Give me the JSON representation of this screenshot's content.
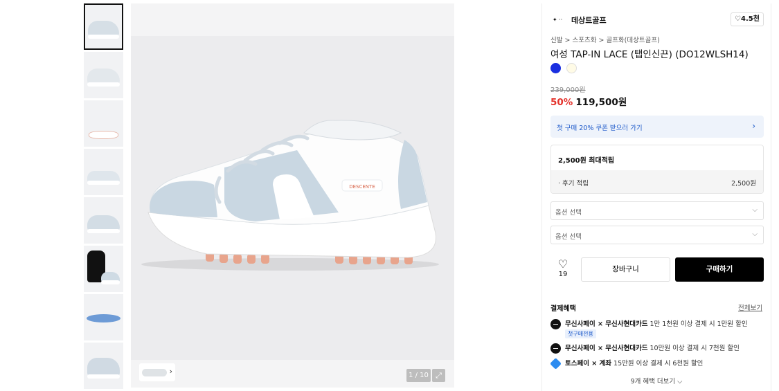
{
  "gallery": {
    "thumbnail_count": 8,
    "counter": "1 / 10",
    "strip_arrow": "›",
    "expand_icon": "⤢"
  },
  "brand": {
    "logo_text": "✦ ··",
    "name": "데상트골프",
    "likes": "♡4.5천"
  },
  "breadcrumb": "신발 > 스포츠화 > 골프화(데상트골프)",
  "product": {
    "title": "여성 TAP-IN LACE (탭인신끈) (DO12WLSH14)",
    "colors": [
      "#1a2fe0",
      "#fffbe6"
    ],
    "original_price": "239,000원",
    "discount": "50%",
    "price": "119,500원"
  },
  "coupon": {
    "text": "첫 구매 20% 쿠폰 받으러 가기",
    "chevron": "›"
  },
  "points": {
    "title": "2,500원 최대적립",
    "row_label": "· 후기 적립",
    "row_value": "2,500원"
  },
  "options": [
    {
      "placeholder": "옵션 선택"
    },
    {
      "placeholder": "옵션 선택"
    }
  ],
  "actions": {
    "wish_icon": "♡",
    "wish_count": "19",
    "cart": "장바구니",
    "buy": "구매하기"
  },
  "benefits": {
    "title": "결제혜택",
    "view_all": "전체보기",
    "items": [
      {
        "partner": "무신사페이 × 무신사현대카드",
        "detail": " 1만 1천원 이상 결제 시 1만원 할인",
        "badge": "첫구매전용"
      },
      {
        "partner": "무신사페이 × 무신사현대카드",
        "detail": " 10만원 이상 결제 시 7천원 할인"
      },
      {
        "partner": "토스페이 × 계좌",
        "detail": " 15만원 이상 결제 시 6천원 할인"
      }
    ],
    "more": "9개 혜택 더보기 ⌵"
  },
  "product_label": "DESCENTE"
}
